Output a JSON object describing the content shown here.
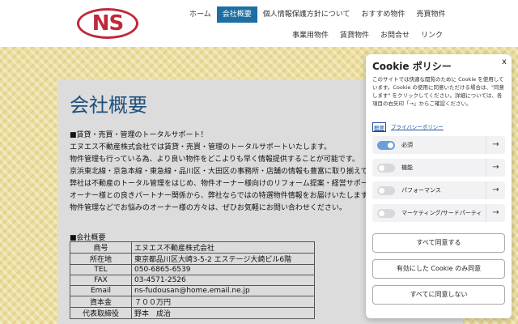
{
  "header": {
    "logo_text": "NS",
    "nav_row1": [
      "ホーム",
      "会社概要",
      "個人情報保護方針について",
      "おすすめ物件",
      "売買物件"
    ],
    "nav_row2": [
      "事業用物件",
      "賃貸物件",
      "お問合せ",
      "リンク"
    ],
    "active": "会社概要"
  },
  "main": {
    "title": "会社概要",
    "intro_lines": [
      "■賃貸・売買・管理のトータルサポート！",
      "エヌエス不動産株式会社では賃貸・売買・管理のトータルサポートいたします。",
      "物件管理も行っている為、より良い物件をどこよりも早く情報提供することが可能です。",
      "京浜東北線・京急本線・東急線・品川区・大田区の事務所・店舗の情報も豊富に取り揃えて",
      "弊社は不動産のトータル管理をはじめ、物件オーナー様向けのリフォーム提案・経営サポー",
      "オーナー様との良きパートナー関係から、弊社ならではの特選物件情報をお届けいたします",
      "物件管理などでお悩みのオーナー様の方々は、ぜひお気軽にお問い合わせください。"
    ],
    "table_title": "■会社概要",
    "table_rows": [
      [
        "商号",
        "エヌエス不動産株式会社"
      ],
      [
        "所在地",
        "東京都品川区大崎3-5-2 エステージ大崎ビル6階"
      ],
      [
        "TEL",
        "050-6865-6539"
      ],
      [
        "FAX",
        "03-4571-2526"
      ],
      [
        "Email",
        "ns-fudousan@home.email.ne.jp"
      ],
      [
        "資本金",
        "７００万円"
      ],
      [
        "代表取締役",
        "野本　成治"
      ]
    ]
  },
  "cookie": {
    "title": "Cookie ポリシー",
    "close": "x",
    "description": "このサイトでは快適な閲覧のために Cookie を使用しています。Cookie の使用に同意いただける場合は、\"同意します\" をクリックしてください。詳細については、各項目の右矢印「→」からご確認ください。",
    "link_summary": "概要",
    "link_privacy": "プライバシーポリシー",
    "categories": [
      {
        "label": "必須",
        "on": true
      },
      {
        "label": "機能",
        "on": false
      },
      {
        "label": "パフォーマンス",
        "on": false
      },
      {
        "label": "マーケティング/サードパーティ",
        "on": false
      }
    ],
    "arrow": "→",
    "btn_accept_all": "すべて同意する",
    "btn_accept_selected": "有効にした Cookie のみ同意",
    "btn_reject_all": "すべてに同意しない",
    "accent_color": "#6aa0d8"
  }
}
